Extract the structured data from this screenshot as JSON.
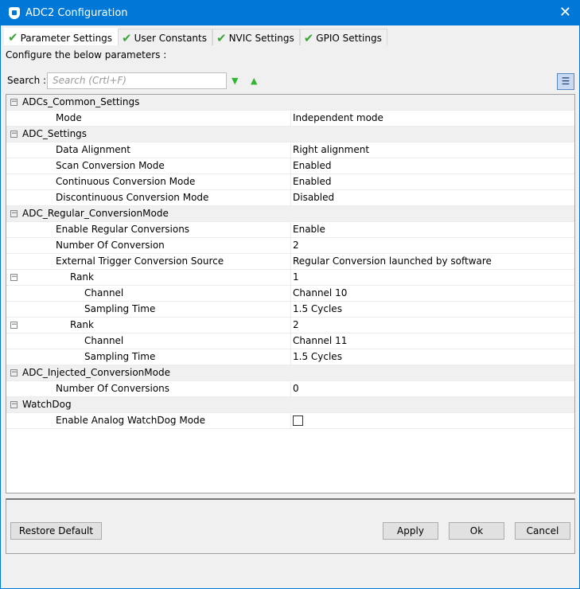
{
  "title": "ADC2 Configuration",
  "tabs": [
    "Parameter Settings",
    "User Constants",
    "NVIC Settings",
    "GPIO Settings"
  ],
  "configure_label": "Configure the below parameters :",
  "search": {
    "label": "Search :",
    "placeholder": "Search (Crtl+F)"
  },
  "rows": [
    {
      "type": "group",
      "name": "ADCs_Common_Settings"
    },
    {
      "type": "param",
      "level": 1,
      "name": "Mode",
      "value": "Independent mode"
    },
    {
      "type": "group",
      "name": "ADC_Settings"
    },
    {
      "type": "param",
      "level": 1,
      "name": "Data Alignment",
      "value": "Right alignment"
    },
    {
      "type": "param",
      "level": 1,
      "name": "Scan Conversion Mode",
      "value": "Enabled"
    },
    {
      "type": "param",
      "level": 1,
      "name": "Continuous Conversion Mode",
      "value": "Enabled"
    },
    {
      "type": "param",
      "level": 1,
      "name": "Discontinuous Conversion Mode",
      "value": "Disabled"
    },
    {
      "type": "group",
      "name": "ADC_Regular_ConversionMode"
    },
    {
      "type": "param",
      "level": 1,
      "name": "Enable Regular Conversions",
      "value": "Enable"
    },
    {
      "type": "param",
      "level": 1,
      "name": "Number Of Conversion",
      "value": "2"
    },
    {
      "type": "param",
      "level": 1,
      "name": "External Trigger Conversion Source",
      "value": "Regular Conversion launched by software"
    },
    {
      "type": "sub",
      "level": 2,
      "name": "Rank",
      "value": "1"
    },
    {
      "type": "param",
      "level": 3,
      "name": "Channel",
      "value": "Channel 10"
    },
    {
      "type": "param",
      "level": 3,
      "name": "Sampling Time",
      "value": "1.5 Cycles"
    },
    {
      "type": "sub",
      "level": 2,
      "name": "Rank",
      "value": "2"
    },
    {
      "type": "param",
      "level": 3,
      "name": "Channel",
      "value": "Channel 11"
    },
    {
      "type": "param",
      "level": 3,
      "name": "Sampling Time",
      "value": "1.5 Cycles"
    },
    {
      "type": "group",
      "name": "ADC_Injected_ConversionMode"
    },
    {
      "type": "param",
      "level": 1,
      "name": "Number Of Conversions",
      "value": "0"
    },
    {
      "type": "group",
      "name": "WatchDog"
    },
    {
      "type": "check",
      "level": 1,
      "name": "Enable Analog WatchDog Mode",
      "checked": false
    }
  ],
  "buttons": {
    "restore": "Restore Default",
    "apply": "Apply",
    "ok": "Ok",
    "cancel": "Cancel"
  }
}
